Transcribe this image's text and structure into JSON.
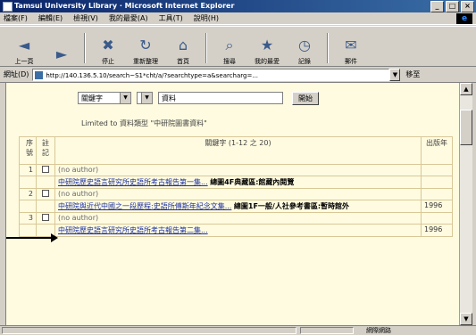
{
  "window": {
    "title": "Tamsui University Library · Microsoft Internet Explorer",
    "controls": [
      "_",
      "□",
      "×"
    ]
  },
  "menu": [
    "檔案(F)",
    "編輯(E)",
    "檢視(V)",
    "我的最愛(A)",
    "工具(T)",
    "說明(H)"
  ],
  "toolbar": [
    {
      "label": "上一頁",
      "icon": "back-icon"
    },
    {
      "label": "",
      "icon": "forward-icon"
    },
    {
      "label": "停止",
      "icon": "stop-icon"
    },
    {
      "label": "重新整理",
      "icon": "refresh-icon"
    },
    {
      "label": "首頁",
      "icon": "home-icon"
    },
    {
      "label": "搜尋",
      "icon": "search-icon"
    },
    {
      "label": "我的最愛",
      "icon": "favorites-icon"
    },
    {
      "label": "記錄",
      "icon": "history-icon"
    },
    {
      "label": "郵件",
      "icon": "mail-icon"
    }
  ],
  "address": {
    "label": "網址(D)",
    "url": "http://140.136.5.10/search~S1*cht/a/?searchtype=a&searcharg=...",
    "go_label": "移至"
  },
  "search": {
    "field_select": "關鍵字",
    "query": "資料",
    "button": "開始"
  },
  "limit_note": "Limited to 資料類型 \"中研院圖書資料\"",
  "table": {
    "headers": {
      "num": "序號",
      "mark": "註記",
      "title": "關鍵字 (1-12 之 20)",
      "year": "出版年"
    },
    "rows": [
      {
        "num": "1",
        "author": "(no author)",
        "title": "中研院歷史語言研究所史語所考古報告第一集...",
        "collection": "總圖4F典藏區:館藏內閱覽",
        "year": ""
      },
      {
        "num": "2",
        "author": "(no author)",
        "title": "中研院與近代中國之一段歷程:史語所傅斯年紀念文集...",
        "collection": "總圖1F一般/人社參考書區:暫時館外",
        "year": "1996"
      },
      {
        "num": "3",
        "author": "(no author)",
        "title": "中研院歷史語言研究所史語所考古報告第二集...",
        "collection": "",
        "year": "1996"
      }
    ]
  },
  "status": {
    "zone": "網際網路"
  }
}
